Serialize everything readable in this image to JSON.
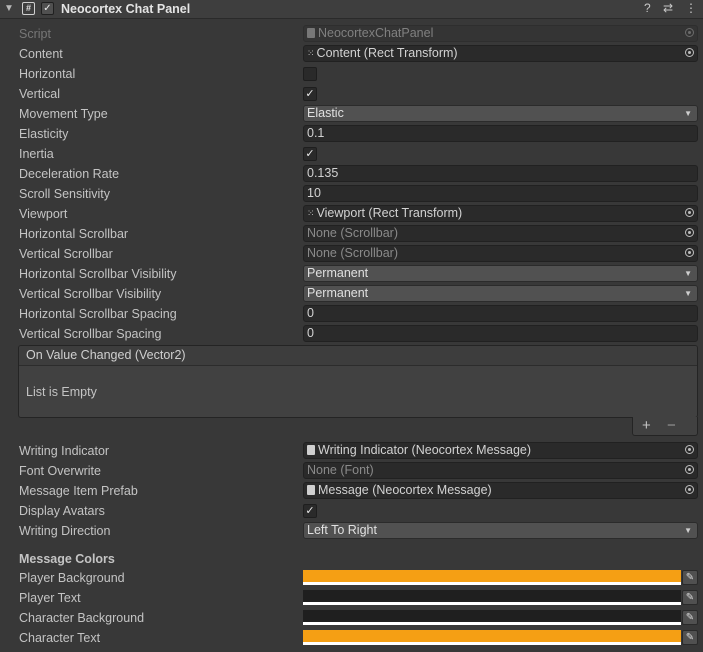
{
  "header": {
    "title": "Neocortex Chat Panel",
    "foldout_icon": "triangle-down-icon",
    "script_icon": "hash-script-icon",
    "enabled_check": "✓",
    "help_icon": "?",
    "presets_icon": "⇄",
    "menu_icon": "⋮"
  },
  "rows": [
    {
      "label": "Script",
      "kind": "object",
      "value": "NeocortexChatPanel",
      "icon": "file",
      "disabled": true
    },
    {
      "label": "Content",
      "kind": "object",
      "value": "Content (Rect Transform)",
      "icon": "rect"
    },
    {
      "label": "Horizontal",
      "kind": "checkbox",
      "checked": ""
    },
    {
      "label": "Vertical",
      "kind": "checkbox",
      "checked": "✓"
    },
    {
      "label": "Movement Type",
      "kind": "dropdown",
      "value": "Elastic"
    },
    {
      "label": "Elasticity",
      "kind": "text",
      "value": "0.1"
    },
    {
      "label": "Inertia",
      "kind": "checkbox",
      "checked": "✓"
    },
    {
      "label": "Deceleration Rate",
      "kind": "text",
      "value": "0.135"
    },
    {
      "label": "Scroll Sensitivity",
      "kind": "text",
      "value": "10"
    },
    {
      "label": "Viewport",
      "kind": "object",
      "value": "Viewport (Rect Transform)",
      "icon": "rect"
    },
    {
      "label": "Horizontal Scrollbar",
      "kind": "object",
      "value": "None (Scrollbar)",
      "muted": true
    },
    {
      "label": "Vertical Scrollbar",
      "kind": "object",
      "value": "None (Scrollbar)",
      "muted": true
    },
    {
      "label": "Horizontal Scrollbar Visibility",
      "kind": "dropdown",
      "value": "Permanent"
    },
    {
      "label": "Vertical Scrollbar Visibility",
      "kind": "dropdown",
      "value": "Permanent"
    },
    {
      "label": "Horizontal Scrollbar Spacing",
      "kind": "text",
      "value": "0"
    },
    {
      "label": "Vertical Scrollbar Spacing",
      "kind": "text",
      "value": "0"
    }
  ],
  "event": {
    "title": "On Value Changed (Vector2)",
    "empty_text": "List is Empty",
    "add_label": "+",
    "remove_label": "−"
  },
  "rows2": [
    {
      "label": "Writing Indicator",
      "kind": "object",
      "value": "Writing Indicator (Neocortex Message)",
      "icon": "file"
    },
    {
      "label": "Font Overwrite",
      "kind": "object",
      "value": "None (Font)",
      "muted": true
    },
    {
      "label": "Message Item Prefab",
      "kind": "object",
      "value": "Message (Neocortex Message)",
      "icon": "file"
    },
    {
      "label": "Display Avatars",
      "kind": "checkbox",
      "checked": "✓"
    },
    {
      "label": "Writing Direction",
      "kind": "dropdown",
      "value": "Left To Right"
    }
  ],
  "colors_section": {
    "title": "Message Colors",
    "items": [
      {
        "label": "Player Background",
        "color": "#f59f14"
      },
      {
        "label": "Player Text",
        "color": "#1f1f1f"
      },
      {
        "label": "Character Background",
        "color": "#1f1f1f"
      },
      {
        "label": "Character Text",
        "color": "#f59f14"
      }
    ]
  }
}
